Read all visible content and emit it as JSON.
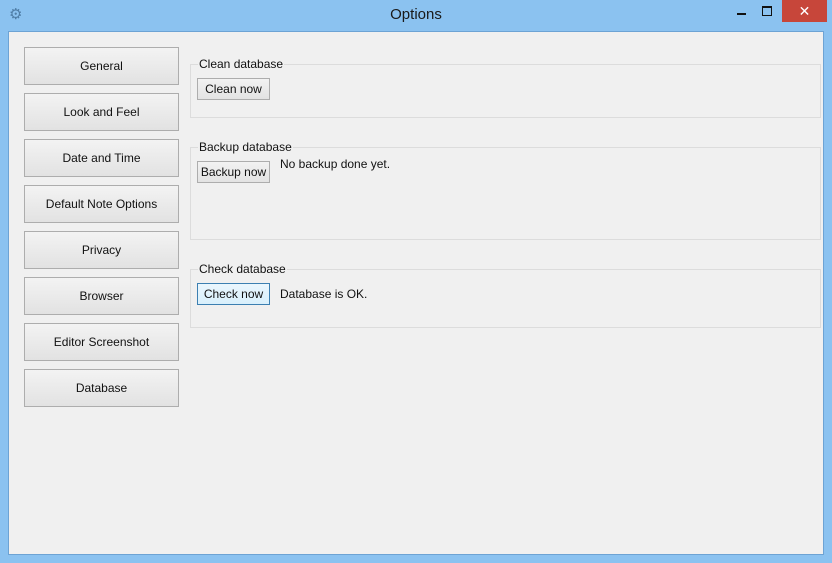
{
  "window": {
    "title": "Options"
  },
  "nav": {
    "items": [
      {
        "label": "General"
      },
      {
        "label": "Look and Feel"
      },
      {
        "label": "Date and Time"
      },
      {
        "label": "Default Note Options"
      },
      {
        "label": "Privacy"
      },
      {
        "label": "Browser"
      },
      {
        "label": "Editor Screenshot"
      },
      {
        "label": "Database"
      }
    ]
  },
  "sections": {
    "clean": {
      "label": "Clean database",
      "button": "Clean now"
    },
    "backup": {
      "label": "Backup database",
      "button": "Backup now",
      "status": "No backup done yet."
    },
    "check": {
      "label": "Check database",
      "button": "Check now",
      "status": "Database is OK."
    }
  },
  "icons": {
    "app": "gear-icon",
    "minimize": "minimize-icon",
    "maximize": "maximize-icon",
    "close": "close-icon"
  }
}
